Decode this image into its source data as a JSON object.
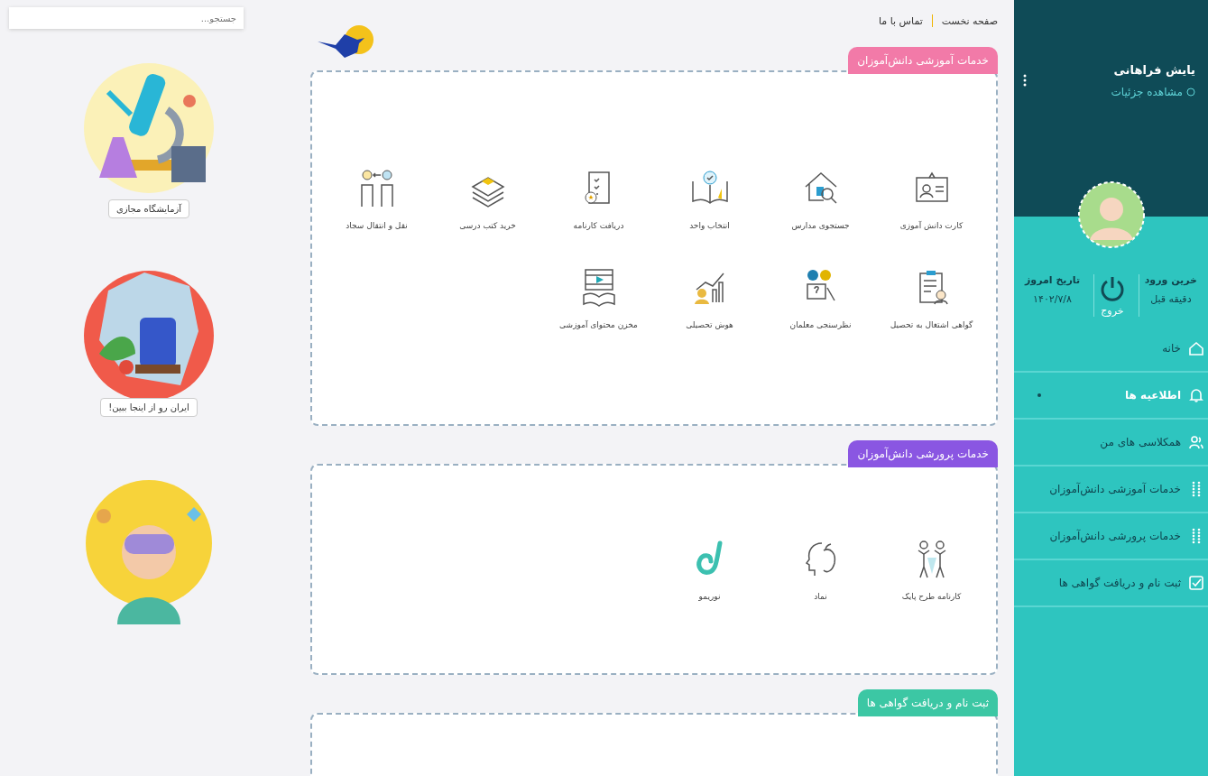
{
  "search": {
    "placeholder": "جستجو..."
  },
  "nav": [
    {
      "label": "صفحه نخست"
    },
    {
      "label": "تماس با ما"
    }
  ],
  "sidebar": {
    "user_name": "یایش فراهانی",
    "details_link": "مشاهده جزئیات",
    "stats": [
      {
        "kind": "info",
        "label": "خرین ورود",
        "value": "دقیقه قبل"
      },
      {
        "kind": "logout",
        "label": "خروج"
      },
      {
        "kind": "info",
        "label": "تاریخ امروز",
        "value": "۱۴۰۲/۷/۸"
      }
    ],
    "menu": [
      {
        "label": "خانه",
        "unread": false
      },
      {
        "label": "اطلاعیه ها",
        "unread": true
      },
      {
        "label": "همکلاسی های من",
        "unread": false
      },
      {
        "label": "خدمات آموزشی دانش‌آموزان",
        "unread": false
      },
      {
        "label": "خدمات پرورشی دانش‌آموزان",
        "unread": false
      },
      {
        "label": "ثبت نام و دریافت گواهی ها",
        "unread": false
      }
    ]
  },
  "sections": [
    {
      "title": "خدمات آموزشی دانش‌آموزان",
      "color": "#f27aa8",
      "items": [
        {
          "label": "کارت دانش آموزی"
        },
        {
          "label": "جستجوی مدارس"
        },
        {
          "label": "انتخاب واحد"
        },
        {
          "label": "دریافت کارنامه"
        },
        {
          "label": "خرید کتب درسی"
        },
        {
          "label": "نقل و انتقال سجاد"
        },
        {
          "label": "گواهی اشتغال به تحصیل"
        },
        {
          "label": "نظرسنجی معلمان"
        },
        {
          "label": "هوش تحصیلی"
        },
        {
          "label": "مخزن محتوای آموزشی"
        }
      ]
    },
    {
      "title": "خدمات پرورشی دانش‌آموزان",
      "color": "#8a56e2",
      "items": [
        {
          "label": "کارنامه طرح پایک"
        },
        {
          "label": "نماد"
        },
        {
          "label": "نوریمو"
        }
      ]
    },
    {
      "title": "ثبت نام و دریافت گواهی ها",
      "color": "#3cc7a4"
    }
  ],
  "promos": [
    {
      "kind": "picture",
      "caption": "آزمایشگاه مجازی"
    },
    {
      "kind": "picture",
      "caption": "ایران رو از اینجا ببین!"
    },
    {
      "kind": "picture"
    }
  ]
}
